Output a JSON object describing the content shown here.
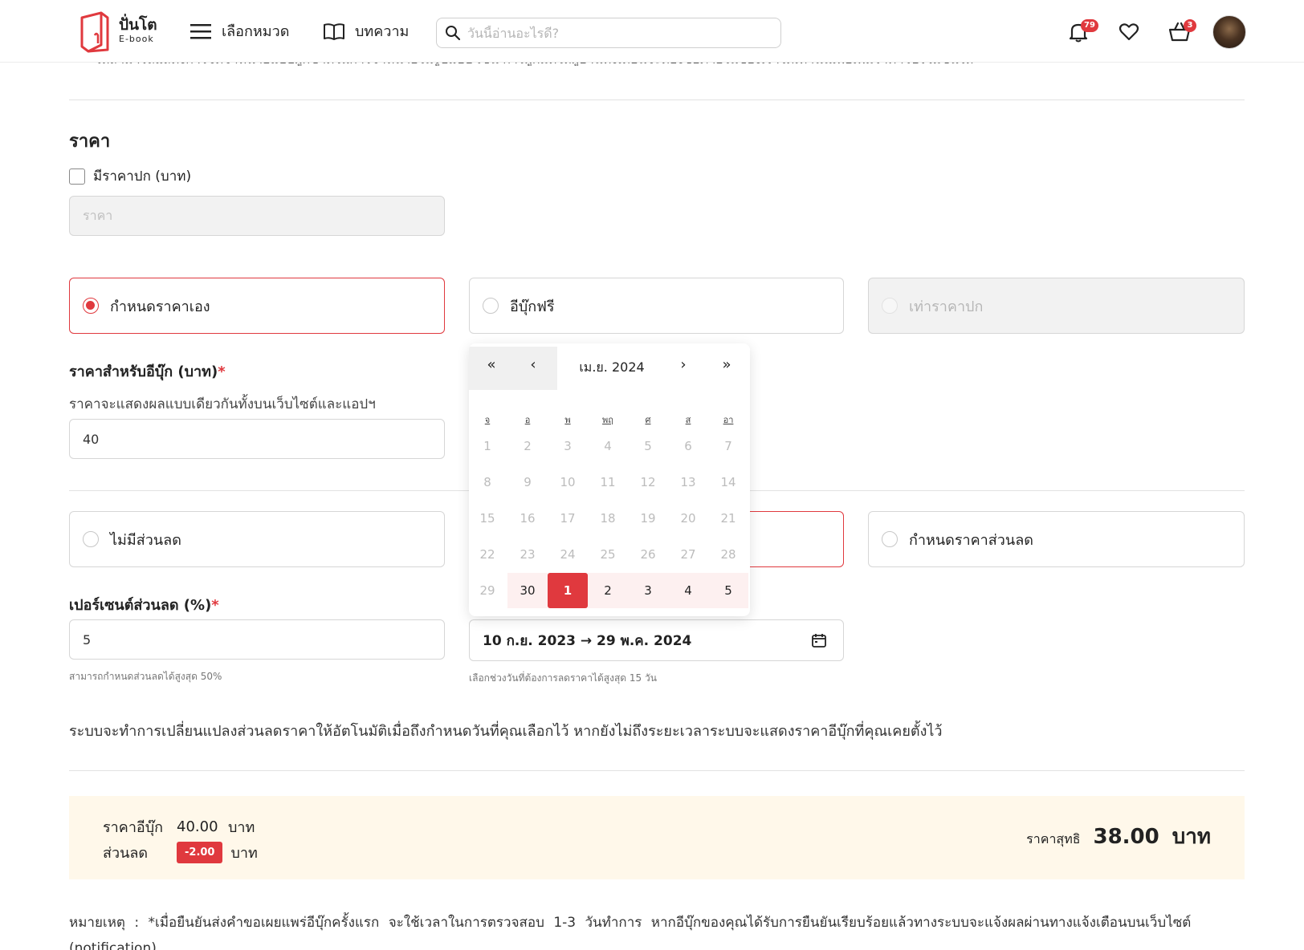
{
  "header": {
    "logo_name": "ปั่นโต",
    "logo_sub": "E-book",
    "menu_label": "เลือกหมวด",
    "articles_label": "บทความ",
    "search_placeholder": "วันนี้อ่านอะไรดี?",
    "notifications_count": "79",
    "cart_count": "3"
  },
  "cut_text": "ให้สามารถแสดงการจัดจำหน่ายแบบผูกขาดในการจำหน่ายในรูปแบบ เช่น การผูกมัดให้ผู้อ่านทั้งเดือนจะต้องซื้อภายในของเราได้เท่านั้นเพื่อเพิ่มราคาโปรโมชั่นให้",
  "price": {
    "section_title": "ราคา",
    "cover_price_checkbox_label": "มีราคาปก (บาท)",
    "cover_price_placeholder": "ราคา",
    "options": [
      {
        "label": "กำหนดราคาเอง",
        "selected": true
      },
      {
        "label": "อีบุ๊กฟรี",
        "selected": false
      },
      {
        "label": "เท่าราคาปก",
        "selected": false,
        "disabled": true
      }
    ],
    "ebook_price_label": "ราคาสำหรับอีบุ๊ก (บาท)",
    "required_mark": "*",
    "ebook_price_help": "ราคาจะแสดงผลแบบเดียวกันทั้งบนเว็บไซต์และแอปฯ",
    "ebook_price_value": "40"
  },
  "discount": {
    "options": [
      {
        "label": "ไม่มีส่วนลด",
        "selected": false
      },
      {
        "label": "",
        "selected": true
      },
      {
        "label": "กำหนดราคาส่วนลด",
        "selected": false
      }
    ],
    "percent_label": "เปอร์เซนต์ส่วนลด (%)",
    "percent_value": "5",
    "percent_help": "สามารถกำหนดส่วนลดได้สูงสุด 50%",
    "date_range_value": "10 ก.ย. 2023 → 29 พ.ค. 2024",
    "date_help": "เลือกช่วงวันที่ต้องการลดราคาได้สูงสุด 15 วัน",
    "auto_note": "ระบบจะทำการเปลี่ยนแปลงส่วนลดราคาให้อัตโนมัติเมื่อถึงกำหนดวันที่คุณเลือกไว้ หากยังไม่ถึงระยะเวลาระบบจะแสดงราคาอีบุ๊กที่คุณเคยตั้งไว้"
  },
  "calendar": {
    "nav_first": "«",
    "nav_prev": "‹",
    "nav_next": "›",
    "nav_last": "»",
    "title": "เม.ย. 2024",
    "weekdays": [
      "จ",
      "อ",
      "พ",
      "พฤ",
      "ศ",
      "ส",
      "อา"
    ],
    "weeks": [
      [
        "1",
        "2",
        "3",
        "4",
        "5",
        "6",
        "7"
      ],
      [
        "8",
        "9",
        "10",
        "11",
        "12",
        "13",
        "14"
      ],
      [
        "15",
        "16",
        "17",
        "18",
        "19",
        "20",
        "21"
      ],
      [
        "22",
        "23",
        "24",
        "25",
        "26",
        "27",
        "28"
      ],
      [
        "29",
        "30",
        "1",
        "2",
        "3",
        "4",
        "5"
      ]
    ],
    "selected_day": "1"
  },
  "summary": {
    "ebook_price_label": "ราคาอีบุ๊ก",
    "ebook_price_value": "40.00",
    "currency": "บาท",
    "discount_label": "ส่วนลด",
    "discount_value": "-2.00",
    "net_label": "ราคาสุทธิ",
    "net_value": "38.00"
  },
  "footnote": "หมายเหตุ : *เมื่อยืนยันส่งคำขอเผยแพร่อีบุ๊กครั้งแรก จะใช้เวลาในการตรวจสอบ 1-3 วันทำการ หากอีบุ๊กของคุณได้รับการยืนยันเรียบร้อยแล้วทางระบบจะแจ้งผลผ่านทางแจ้งเตือนบนเว็บไซต์",
  "footnote_cont": "(notification)",
  "colors": {
    "accent": "#e0393e",
    "summary_bg": "#fff8ea"
  }
}
